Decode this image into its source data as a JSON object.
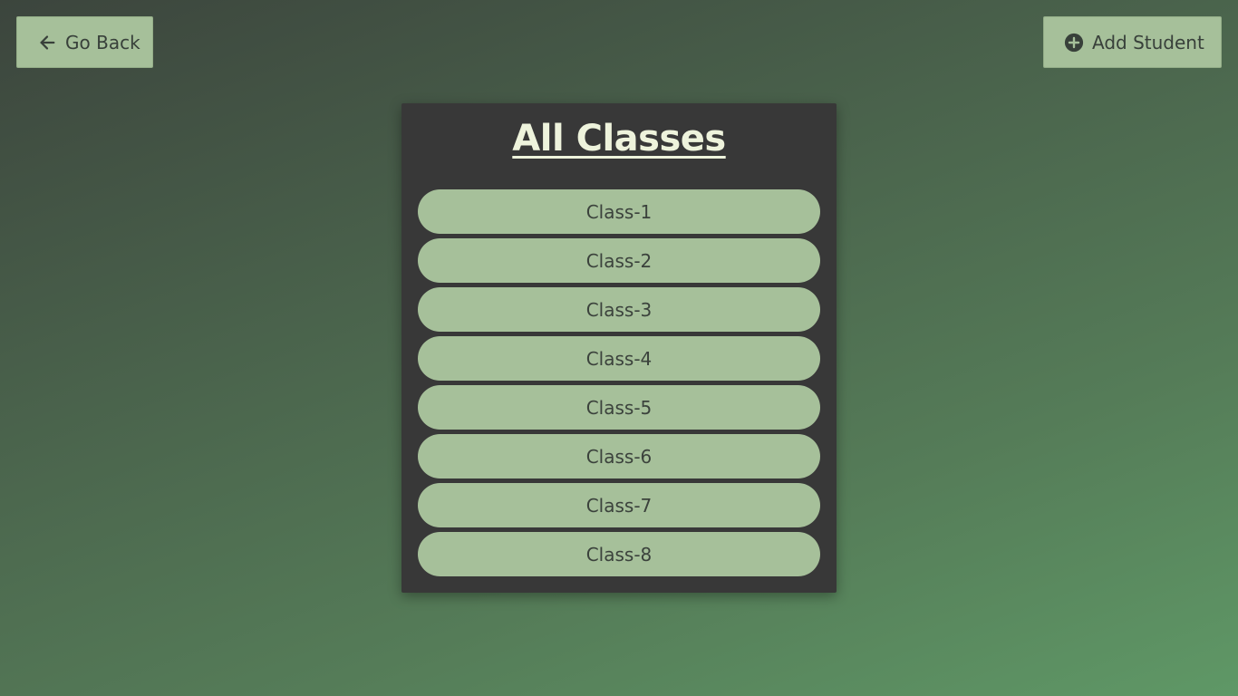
{
  "header": {
    "back_label": "Go Back",
    "back_icon": "arrow-left-icon",
    "add_label": "Add Student",
    "add_icon": "plus-circle-icon"
  },
  "panel": {
    "title": "All Classes",
    "classes": [
      {
        "label": "Class-1"
      },
      {
        "label": "Class-2"
      },
      {
        "label": "Class-3"
      },
      {
        "label": "Class-4"
      },
      {
        "label": "Class-5"
      },
      {
        "label": "Class-6"
      },
      {
        "label": "Class-7"
      },
      {
        "label": "Class-8"
      }
    ]
  },
  "colors": {
    "button_bg": "#a6c09a",
    "panel_bg": "#383838",
    "title_color": "#eef3dc",
    "text_dark": "#3b423c"
  }
}
